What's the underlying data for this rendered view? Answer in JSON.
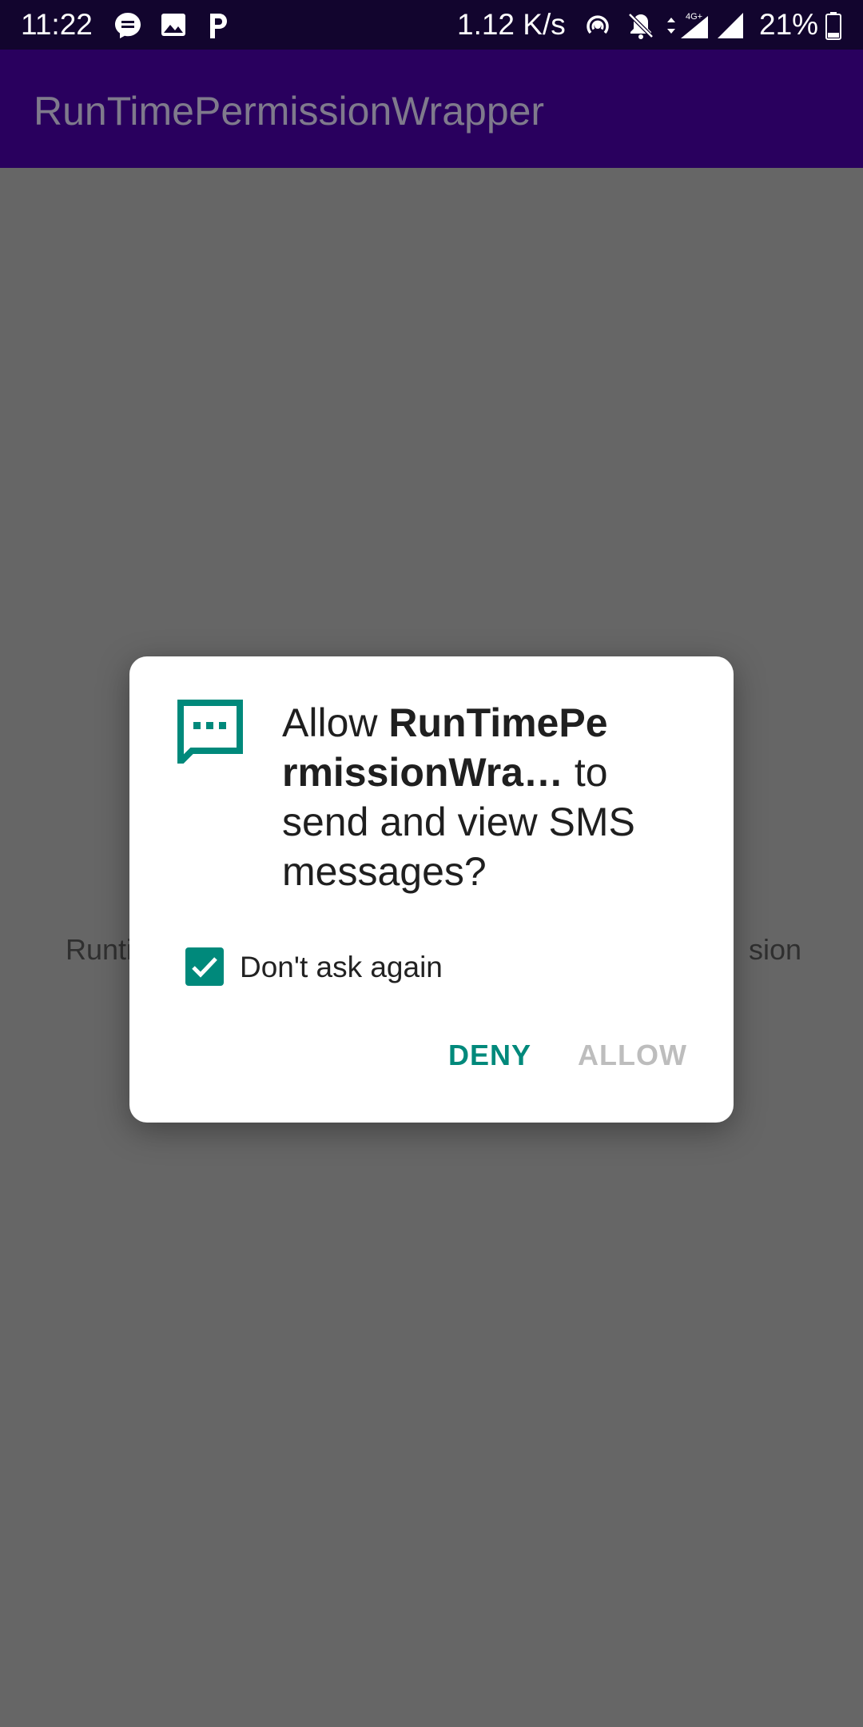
{
  "status_bar": {
    "time": "11:22",
    "net_speed": "1.12 K/s",
    "battery": "21%",
    "network_type": "4G+",
    "icons": [
      "messenger-icon",
      "image-icon",
      "parking-icon",
      "hotspot-icon",
      "mute-icon",
      "data-arrows-icon",
      "signal-icon",
      "wifi-signal-icon",
      "battery-icon"
    ]
  },
  "app_bar": {
    "title": "RunTimePermissionWrapper"
  },
  "background": {
    "body_text_start": "Runti",
    "body_text_end": "sion."
  },
  "dialog": {
    "icon": "sms-message-icon",
    "heading_prefix": "Allow ",
    "app_name": "RunTimePermissionWra…",
    "app_name_line1": "RunTimePe",
    "app_name_line2": "rmissionWra…",
    "heading_suffix_1": " to",
    "heading_suffix_2": "send and view SMS",
    "heading_suffix_3": "messages?",
    "checkbox_label": "Don't ask again",
    "checkbox_checked": true,
    "deny_label": "DENY",
    "allow_label": "ALLOW"
  },
  "colors": {
    "accent": "#00897b",
    "status_bar": "#12052e",
    "app_bar": "#29005e",
    "scrim_background": "#666666",
    "disabled_text": "#bdbdbd"
  }
}
